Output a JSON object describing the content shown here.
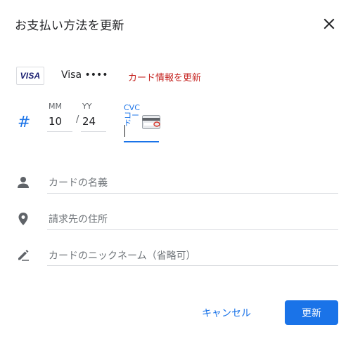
{
  "dialog": {
    "title": "お支払い方法を更新",
    "close_icon": "close-icon"
  },
  "card": {
    "brand_logo": "VISA",
    "masked_number": "Visa ••••",
    "update_link": "カード情報を更新"
  },
  "expiry": {
    "icon": "hash-icon",
    "month_label": "MM",
    "month_value": "10",
    "separator": "/",
    "year_label": "YY",
    "year_value": "24"
  },
  "cvc": {
    "label": "CVC コード",
    "value": "",
    "hint_icon": "card-back-icon"
  },
  "fields": {
    "name_placeholder": "カードの名義",
    "name_icon": "person-icon",
    "address_placeholder": "請求先の住所",
    "address_icon": "location-pin-icon",
    "nickname_placeholder": "カードのニックネーム（省略可）",
    "nickname_icon": "edit-pen-icon"
  },
  "actions": {
    "cancel_label": "キャンセル",
    "update_label": "更新"
  },
  "colors": {
    "accent": "#1a73e8",
    "link_red": "#c5221f",
    "visa_blue": "#1a1f71"
  }
}
